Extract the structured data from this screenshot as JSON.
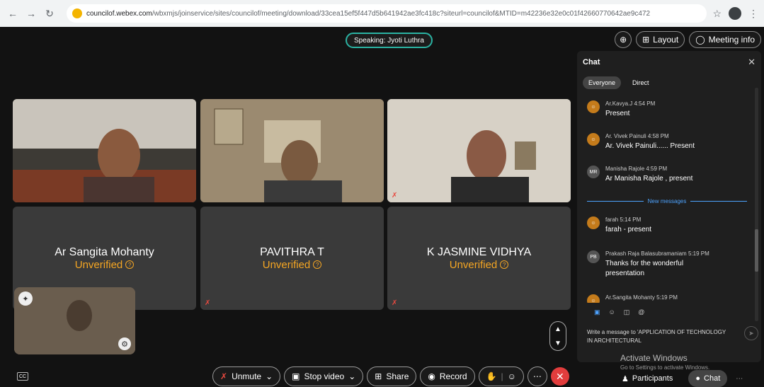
{
  "browser": {
    "url_domain": "councilof.webex.com",
    "url_path": "/wbxmjs/joinservice/sites/councilof/meeting/download/33cea15ef5f447d5b641942ae3fc418c?siteurl=councilof&MTID=m42236e32e0c01f42660770642ae9c472"
  },
  "header": {
    "speaking": "Speaking: Jyoti Luthra",
    "layout_label": "Layout",
    "meeting_info_label": "Meeting info"
  },
  "tiles": [
    {
      "name": "Ar Sangita Mohanty",
      "status": "Unverified"
    },
    {
      "name": "PAVITHRA T",
      "status": "Unverified"
    },
    {
      "name": "K JASMINE VIDHYA",
      "status": "Unverified"
    }
  ],
  "controls": {
    "unmute": "Unmute",
    "stop_video": "Stop video",
    "share": "Share",
    "record": "Record"
  },
  "chat": {
    "title": "Chat",
    "tab_everyone": "Everyone",
    "tab_direct": "Direct",
    "new_messages": "New messages",
    "messages": [
      {
        "initials": "",
        "author": "Ar.Kavya.J",
        "time": "4:54 PM",
        "text": "Present"
      },
      {
        "initials": "",
        "author": "Ar. Vivek Painuli",
        "time": "4:58 PM",
        "text": "Ar. Vivek Painuli...... Present"
      },
      {
        "initials": "MR",
        "author": "Manisha Rajole",
        "time": "4:59 PM",
        "text": "Ar Manisha Rajole , present"
      },
      {
        "initials": "",
        "author": "farah",
        "time": "5:14 PM",
        "text": "farah - present"
      },
      {
        "initials": "PB",
        "author": "Prakash Raja Balasubramaniam",
        "time": "5:19 PM",
        "text": "Thanks for the wonderful presentation"
      },
      {
        "initials": "",
        "author": "Ar.Sangita Mohanty",
        "time": "5:19 PM",
        "text": ""
      }
    ],
    "input_placeholder": "Write a message to 'APPLICATION OF TECHNOLOGY IN ARCHITECTURAL"
  },
  "watermark": {
    "line1": "Activate Windows",
    "line2": "Go to Settings to activate Windows."
  },
  "bottom": {
    "participants": "Participants",
    "chat": "Chat"
  },
  "colors": {
    "accent": "#2bb3a3",
    "unverified": "#f5a623",
    "end_call": "#e23d3d",
    "link": "#4da3ff"
  }
}
